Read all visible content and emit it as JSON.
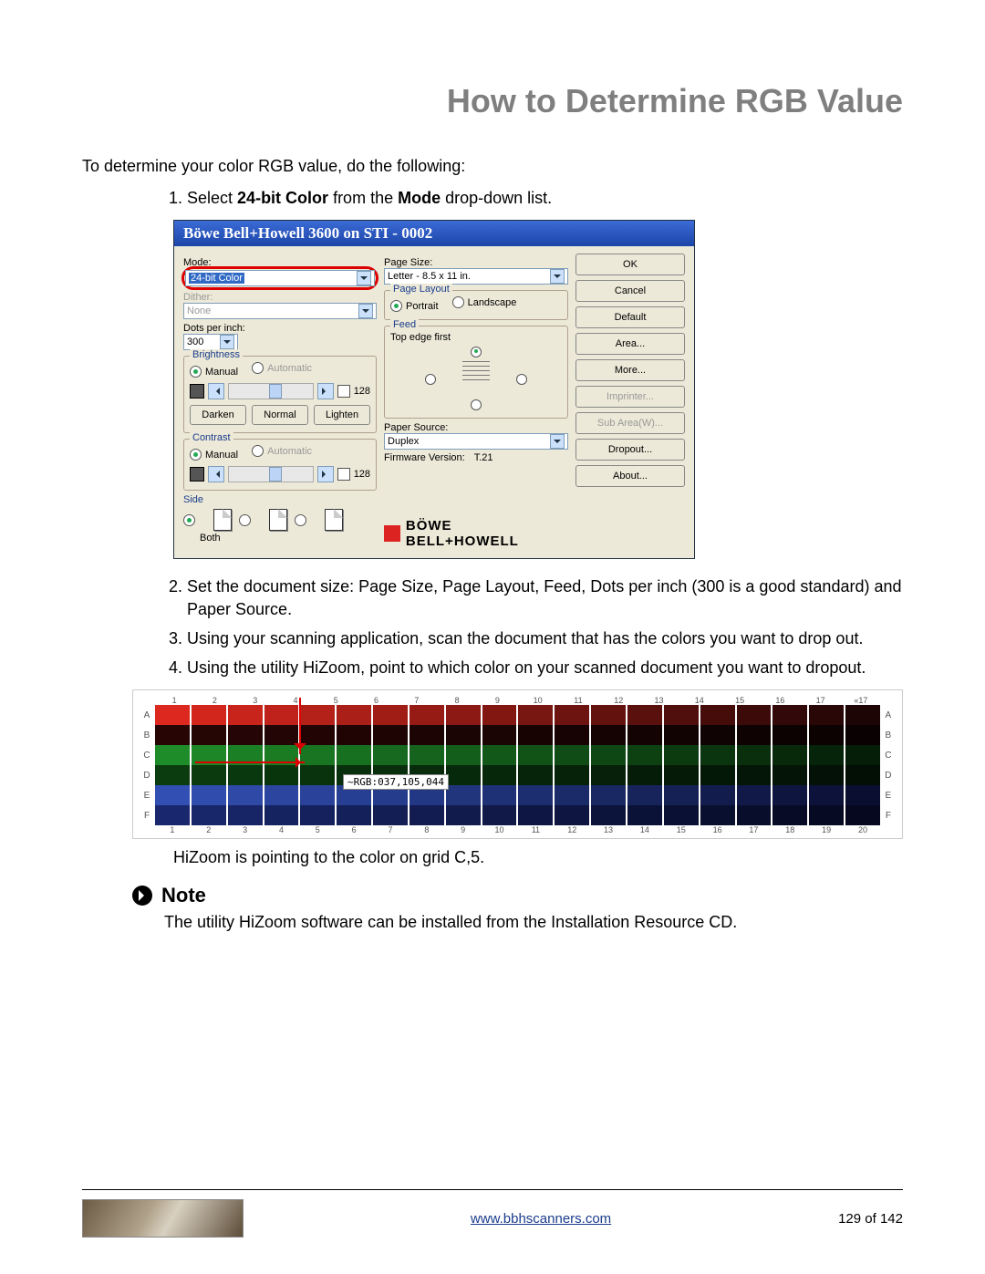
{
  "title": "How to Determine RGB Value",
  "intro": "To determine your color RGB value, do the following:",
  "steps": {
    "s1_pre": "1. Select ",
    "s1_b1": "24-bit Color",
    "s1_mid": " from the ",
    "s1_b2": "Mode",
    "s1_post": " drop-down list.",
    "s2": "2. Set the document size: Page Size, Page Layout, Feed, Dots per inch (300 is a good standard) and Paper Source.",
    "s3": "3. Using your scanning application, scan the document that has the colors you want to drop out.",
    "s4": "4. Using the utility HiZoom, point to which color on your scanned document you want to dropout."
  },
  "dialog": {
    "title": "Böwe Bell+Howell 3600 on STI - 0002",
    "modeLbl": "Mode:",
    "modeVal": "24-bit Color",
    "ditherLbl": "Dither:",
    "ditherVal": "None",
    "dpiLbl": "Dots per inch:",
    "dpiVal": "300",
    "brightnessLegend": "Brightness",
    "manual": "Manual",
    "automatic": "Automatic",
    "sliderVal": "128",
    "darken": "Darken",
    "normal": "Normal",
    "lighten": "Lighten",
    "contrastLegend": "Contrast",
    "sideLbl": "Side",
    "sideBoth": "Both",
    "pageSizeLbl": "Page Size:",
    "pageSizeVal": "Letter - 8.5 x 11 in.",
    "pageLayoutLegend": "Page Layout",
    "portrait": "Portrait",
    "landscape": "Landscape",
    "feedLegend": "Feed",
    "feedTop": "Top edge first",
    "paperSrcLbl": "Paper Source:",
    "paperSrcVal": "Duplex",
    "fwLbl": "Firmware Version:",
    "fwVal": "T.21",
    "logo": "BÖWE BELL+HOWELL",
    "btnOK": "OK",
    "btnCancel": "Cancel",
    "btnDefault": "Default",
    "btnArea": "Area...",
    "btnMore": "More...",
    "btnImprinter": "Imprinter...",
    "btnSubArea": "Sub Area(W)...",
    "btnDropout": "Dropout...",
    "btnAbout": "About..."
  },
  "grid": {
    "rgbTip": "~RGB:037,105,044",
    "closing": "HiZoom is pointing to the color on grid C,5.",
    "rows": [
      "A",
      "B",
      "C",
      "D",
      "E",
      "F"
    ],
    "colsTop": [
      "1",
      "2",
      "3",
      "4",
      "5",
      "6",
      "7",
      "8",
      "9",
      "10",
      "11",
      "12",
      "13",
      "14",
      "15",
      "16",
      "17",
      "«17"
    ],
    "colsBot": [
      "1",
      "2",
      "3",
      "4",
      "5",
      "6",
      "7",
      "8",
      "9",
      "10",
      "11",
      "12",
      "13",
      "14",
      "15",
      "16",
      "17",
      "18",
      "19",
      "20"
    ]
  },
  "note": {
    "head": "Note",
    "body": "The utility HiZoom software can be installed from the Installation Resource CD."
  },
  "footer": {
    "url": "www.bbhscanners.com",
    "page": "129 of 142"
  }
}
